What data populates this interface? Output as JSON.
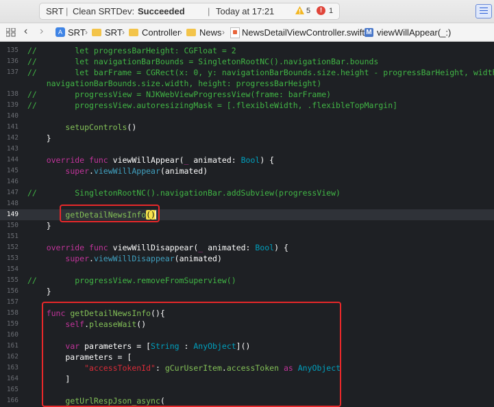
{
  "status": {
    "scheme": "SRT",
    "action": "Clean SRTDev: ",
    "result": "Succeeded",
    "time": "Today at 17:21",
    "warnings": "5",
    "errors": "1"
  },
  "jumpbar": {
    "project": "SRT",
    "group": "SRT",
    "folder1": "Controller",
    "folder2": "News",
    "file": "NewsDetailViewController.swift",
    "method_badge": "M",
    "method": "viewWillAppear(_:)"
  },
  "lines": [
    {
      "n": "135",
      "t": "//        let progressBarHeight: CGFloat = 2"
    },
    {
      "n": "136",
      "t": "//        let navigationBarBounds = SingletonRootNC().navigationBar.bounds"
    },
    {
      "n": "137",
      "t": "//        let barFrame = CGRect(x: 0, y: navigationBarBounds.size.height - progressBarHeight, width:"
    },
    {
      "n": "",
      "t": "    navigationBarBounds.size.width, height: progressBarHeight)"
    },
    {
      "n": "138",
      "t": "//        progressView = NJKWebViewProgressView(frame: barFrame)"
    },
    {
      "n": "139",
      "t": "//        progressView.autoresizingMask = [.flexibleWidth, .flexibleTopMargin]"
    },
    {
      "n": "140",
      "t": ""
    },
    {
      "n": "141",
      "t": "        setupControls()"
    },
    {
      "n": "142",
      "t": "    }"
    },
    {
      "n": "143",
      "t": ""
    },
    {
      "n": "144",
      "t": "    override func viewWillAppear(_ animated: Bool) {"
    },
    {
      "n": "145",
      "t": "        super.viewWillAppear(animated)"
    },
    {
      "n": "146",
      "t": ""
    },
    {
      "n": "147",
      "t": "//        SingletonRootNC().navigationBar.addSubview(progressView)"
    },
    {
      "n": "148",
      "t": ""
    },
    {
      "n": "149",
      "t": "        getDetailNewsInfo()"
    },
    {
      "n": "150",
      "t": "    }"
    },
    {
      "n": "151",
      "t": ""
    },
    {
      "n": "152",
      "t": "    override func viewWillDisappear(_ animated: Bool) {"
    },
    {
      "n": "153",
      "t": "        super.viewWillDisappear(animated)"
    },
    {
      "n": "154",
      "t": ""
    },
    {
      "n": "155",
      "t": "//        progressView.removeFromSuperview()"
    },
    {
      "n": "156",
      "t": "    }"
    },
    {
      "n": "157",
      "t": ""
    },
    {
      "n": "158",
      "t": "    func getDetailNewsInfo(){"
    },
    {
      "n": "159",
      "t": "        self.pleaseWait()"
    },
    {
      "n": "160",
      "t": ""
    },
    {
      "n": "161",
      "t": "        var parameters = [String : AnyObject]()"
    },
    {
      "n": "162",
      "t": "        parameters = ["
    },
    {
      "n": "163",
      "t": "            \"accessTokenId\": gCurUserItem.accessToken as AnyObject"
    },
    {
      "n": "164",
      "t": "        ]"
    },
    {
      "n": "165",
      "t": ""
    },
    {
      "n": "166",
      "t": "        getUrlRespJson_async("
    }
  ]
}
